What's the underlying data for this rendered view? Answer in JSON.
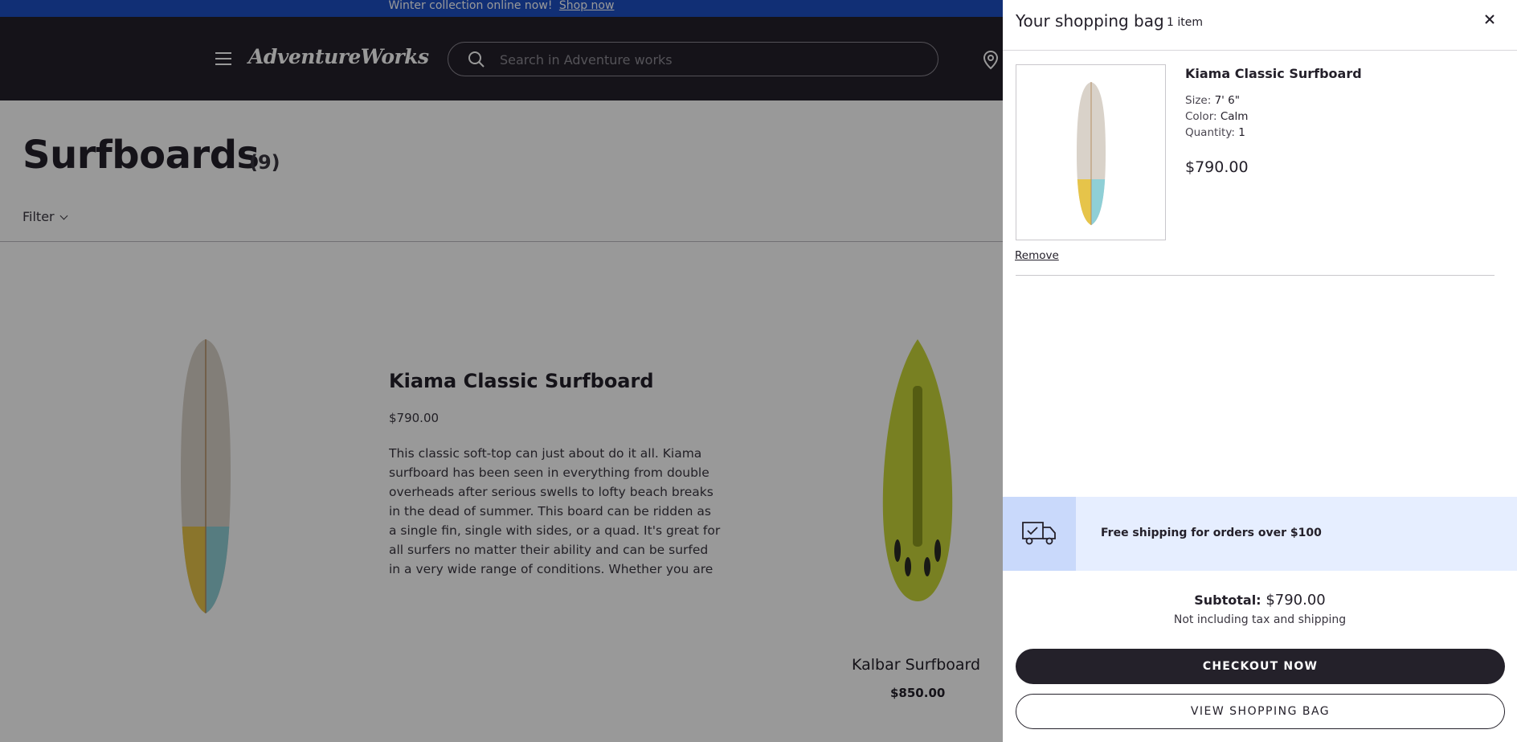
{
  "promo": {
    "text": "Winter collection online now!",
    "link": "Shop now"
  },
  "header": {
    "logo": "AdventureWorks",
    "search_placeholder": "Search in Adventure works"
  },
  "page": {
    "title": "Surfboards",
    "count": "(9)",
    "filter_label": "Filter"
  },
  "products": [
    {
      "name": "Kiama Classic Surfboard",
      "price": "$790.00",
      "description": "This classic soft-top can just about do it all. Kiama surfboard has been seen in everything from double overheads after serious swells to lofty beach breaks in the dead of summer. This board can be ridden as a single fin, single with sides, or a quad. It's great for all surfers no matter their ability and can be surfed in a very wide range of conditions. Whether you are a youn…"
    },
    {
      "name": "Kalbar Surfboard",
      "price": "$850.00"
    }
  ],
  "cart": {
    "title": "Your shopping bag",
    "count": "1 item",
    "item": {
      "name": "Kiama Classic Surfboard",
      "size_label": "Size:",
      "size_value": "7' 6\"",
      "color_label": "Color:",
      "color_value": "Calm",
      "qty_label": "Quantity:",
      "qty_value": "1",
      "price": "$790.00",
      "remove": "Remove"
    },
    "shipping_banner": "Free shipping for orders over $100",
    "subtotal_label": "Subtotal:",
    "subtotal_value": "$790.00",
    "subtotal_note": "Not including tax and shipping",
    "checkout_button": "CHECKOUT NOW",
    "view_bag_button": "VIEW SHOPPING BAG"
  },
  "colors": {
    "promo_bg": "#1d4fc4",
    "nav_bg": "#24212a",
    "banner_bg": "#e6eeff",
    "banner_icon_bg": "#c9d9fb"
  },
  "icons": [
    "menu-icon",
    "search-icon",
    "location-icon",
    "close-icon",
    "delivery-truck-icon"
  ]
}
